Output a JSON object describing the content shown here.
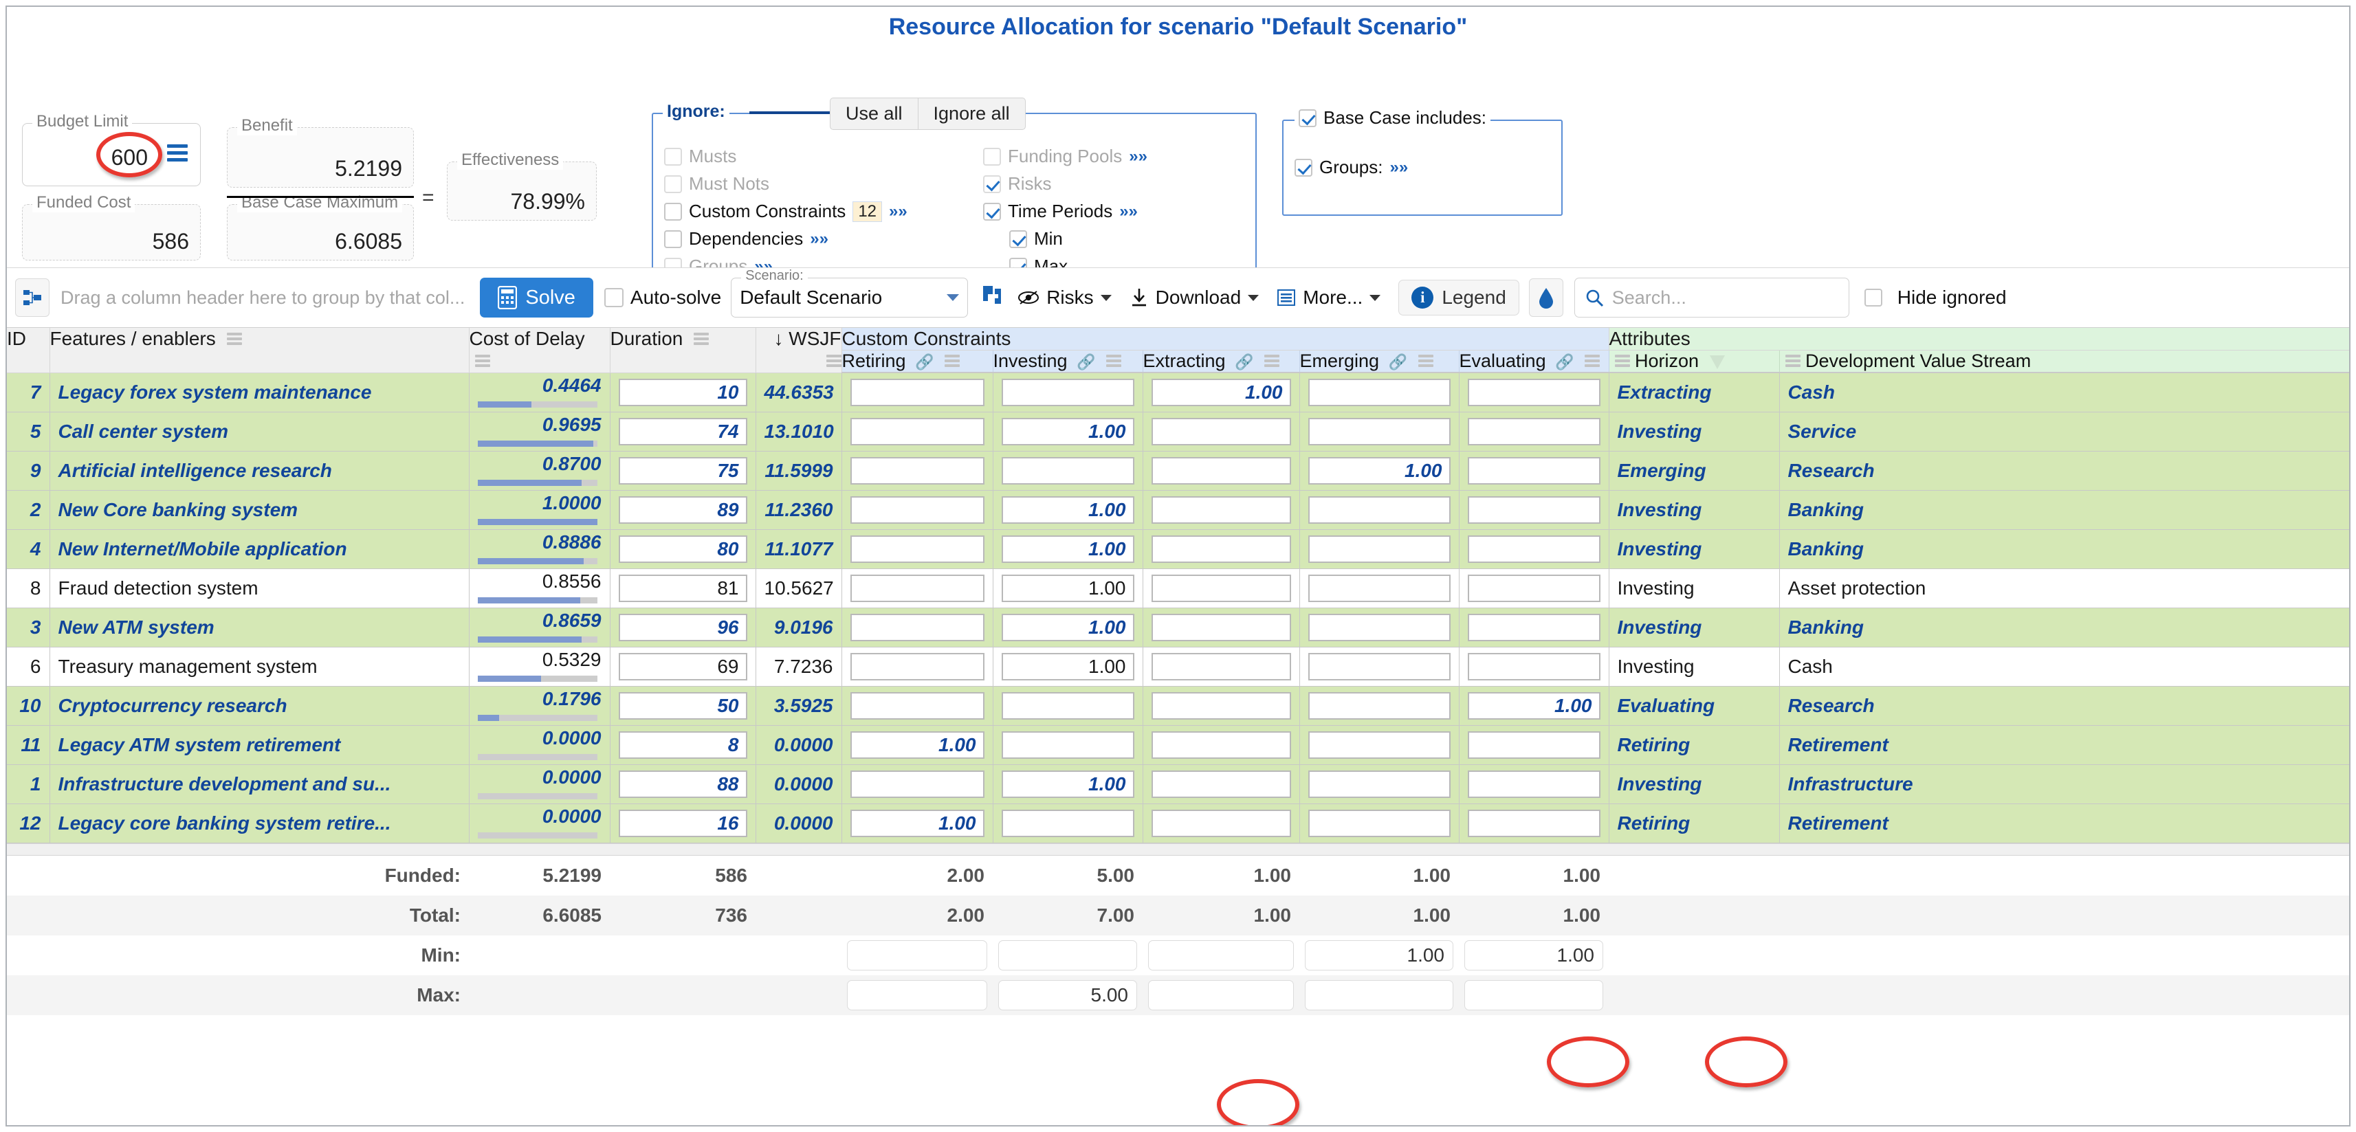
{
  "title": "Resource Allocation for scenario \"Default Scenario\"",
  "metrics": {
    "budget_limit_label": "Budget Limit",
    "budget_limit_value": "600",
    "benefit_label": "Benefit",
    "benefit_value": "5.2199",
    "effectiveness_label": "Effectiveness",
    "effectiveness_value": "78.99%",
    "funded_cost_label": "Funded Cost",
    "funded_cost_value": "586",
    "base_case_max_label": "Base Case Maximum",
    "base_case_max_value": "6.6085",
    "equals_sign": "="
  },
  "ignore_panel": {
    "legend": "Ignore:",
    "use_all": "Use all",
    "ignore_all": "Ignore all",
    "left_items": [
      {
        "label": "Musts",
        "checked": false,
        "dim": true,
        "chevron": false,
        "badge": null
      },
      {
        "label": "Must Nots",
        "checked": false,
        "dim": true,
        "chevron": false,
        "badge": null
      },
      {
        "label": "Custom Constraints",
        "checked": false,
        "dim": false,
        "chevron": true,
        "badge": "12"
      },
      {
        "label": "Dependencies",
        "checked": false,
        "dim": false,
        "chevron": true,
        "badge": null
      },
      {
        "label": "Groups",
        "checked": false,
        "dim": true,
        "chevron": true,
        "badge": null
      }
    ],
    "right_items": [
      {
        "label": "Funding Pools",
        "checked": false,
        "dim": true,
        "chevron": true,
        "indent": 0
      },
      {
        "label": "Risks",
        "checked": true,
        "dim": true,
        "chevron": false,
        "indent": 0
      },
      {
        "label": "Time Periods",
        "checked": true,
        "dim": false,
        "chevron": true,
        "indent": 0
      },
      {
        "label": "Min",
        "checked": true,
        "dim": false,
        "chevron": false,
        "indent": 1
      },
      {
        "label": "Max",
        "checked": true,
        "dim": false,
        "chevron": false,
        "indent": 1
      }
    ]
  },
  "base_case": {
    "title": "Base Case includes:",
    "title_checked": true,
    "groups_label": "Groups:",
    "groups_checked": true,
    "groups_chevron": "»»"
  },
  "toolbar": {
    "group_panel_placeholder": "Drag a column header here to group by that col...",
    "solve_label": "Solve",
    "autosolve_label": "Auto-solve",
    "autosolve_checked": false,
    "scenario_label": "Scenario:",
    "scenario_value": "Default Scenario",
    "risks_label": "Risks",
    "download_label": "Download",
    "more_label": "More...",
    "legend_label": "Legend",
    "search_placeholder": "Search...",
    "hide_ignored_label": "Hide ignored",
    "hide_ignored_checked": false
  },
  "grid": {
    "group_headers": [
      {
        "label": "ID",
        "span": 1
      },
      {
        "label": "Features / enablers",
        "span": 1
      },
      {
        "label": "Cost of Delay",
        "span": 1
      },
      {
        "label": "Duration",
        "span": 1
      },
      {
        "label": "WSJF",
        "span": 1,
        "sort": "↓"
      },
      {
        "label": "Custom Constraints",
        "span": 5,
        "kind": "cc"
      },
      {
        "label": "Attributes",
        "span": 2,
        "kind": "attr"
      }
    ],
    "sub_headers": [
      {
        "label": "Retiring",
        "kind": "cc",
        "link": true
      },
      {
        "label": "Investing",
        "kind": "cc",
        "link": true
      },
      {
        "label": "Extracting",
        "kind": "cc",
        "link": true
      },
      {
        "label": "Emerging",
        "kind": "cc",
        "link": true
      },
      {
        "label": "Evaluating",
        "kind": "cc",
        "link": true
      },
      {
        "label": "Horizon",
        "kind": "attr",
        "funnel": true
      },
      {
        "label": "Development Value Stream",
        "kind": "attr"
      }
    ],
    "rows": [
      {
        "id": "7",
        "name": "Legacy forex system maintenance",
        "cod": "0.4464",
        "cod_pct": 45,
        "duration": "10",
        "wsjf": "44.6353",
        "retiring": "",
        "investing": "",
        "extracting": "1.00",
        "emerging": "",
        "evaluating": "",
        "horizon": "Extracting",
        "dvs": "Cash",
        "funded": true
      },
      {
        "id": "5",
        "name": "Call center system",
        "cod": "0.9695",
        "cod_pct": 97,
        "duration": "74",
        "wsjf": "13.1010",
        "retiring": "",
        "investing": "1.00",
        "extracting": "",
        "emerging": "",
        "evaluating": "",
        "horizon": "Investing",
        "dvs": "Service",
        "funded": true
      },
      {
        "id": "9",
        "name": "Artificial intelligence research",
        "cod": "0.8700",
        "cod_pct": 87,
        "duration": "75",
        "wsjf": "11.5999",
        "retiring": "",
        "investing": "",
        "extracting": "",
        "emerging": "1.00",
        "evaluating": "",
        "horizon": "Emerging",
        "dvs": "Research",
        "funded": true
      },
      {
        "id": "2",
        "name": "New Core banking system",
        "cod": "1.0000",
        "cod_pct": 100,
        "duration": "89",
        "wsjf": "11.2360",
        "retiring": "",
        "investing": "1.00",
        "extracting": "",
        "emerging": "",
        "evaluating": "",
        "horizon": "Investing",
        "dvs": "Banking",
        "funded": true
      },
      {
        "id": "4",
        "name": "New Internet/Mobile application",
        "cod": "0.8886",
        "cod_pct": 89,
        "duration": "80",
        "wsjf": "11.1077",
        "retiring": "",
        "investing": "1.00",
        "extracting": "",
        "emerging": "",
        "evaluating": "",
        "horizon": "Investing",
        "dvs": "Banking",
        "funded": true
      },
      {
        "id": "8",
        "name": "Fraud detection system",
        "cod": "0.8556",
        "cod_pct": 86,
        "duration": "81",
        "wsjf": "10.5627",
        "retiring": "",
        "investing": "1.00",
        "extracting": "",
        "emerging": "",
        "evaluating": "",
        "horizon": "Investing",
        "dvs": "Asset protection",
        "funded": false
      },
      {
        "id": "3",
        "name": "New ATM system",
        "cod": "0.8659",
        "cod_pct": 87,
        "duration": "96",
        "wsjf": "9.0196",
        "retiring": "",
        "investing": "1.00",
        "extracting": "",
        "emerging": "",
        "evaluating": "",
        "horizon": "Investing",
        "dvs": "Banking",
        "funded": true
      },
      {
        "id": "6",
        "name": "Treasury management system",
        "cod": "0.5329",
        "cod_pct": 53,
        "duration": "69",
        "wsjf": "7.7236",
        "retiring": "",
        "investing": "1.00",
        "extracting": "",
        "emerging": "",
        "evaluating": "",
        "horizon": "Investing",
        "dvs": "Cash",
        "funded": false
      },
      {
        "id": "10",
        "name": "Cryptocurrency research",
        "cod": "0.1796",
        "cod_pct": 18,
        "duration": "50",
        "wsjf": "3.5925",
        "retiring": "",
        "investing": "",
        "extracting": "",
        "emerging": "",
        "evaluating": "1.00",
        "horizon": "Evaluating",
        "dvs": "Research",
        "funded": true
      },
      {
        "id": "11",
        "name": "Legacy ATM system retirement",
        "cod": "0.0000",
        "cod_pct": 0,
        "duration": "8",
        "wsjf": "0.0000",
        "retiring": "1.00",
        "investing": "",
        "extracting": "",
        "emerging": "",
        "evaluating": "",
        "horizon": "Retiring",
        "dvs": "Retirement",
        "funded": true
      },
      {
        "id": "1",
        "name": "Infrastructure development and su...",
        "cod": "0.0000",
        "cod_pct": 0,
        "duration": "88",
        "wsjf": "0.0000",
        "retiring": "",
        "investing": "1.00",
        "extracting": "",
        "emerging": "",
        "evaluating": "",
        "horizon": "Investing",
        "dvs": "Infrastructure",
        "funded": true
      },
      {
        "id": "12",
        "name": "Legacy core banking system retire...",
        "cod": "0.0000",
        "cod_pct": 0,
        "duration": "16",
        "wsjf": "0.0000",
        "retiring": "1.00",
        "investing": "",
        "extracting": "",
        "emerging": "",
        "evaluating": "",
        "horizon": "Retiring",
        "dvs": "Retirement",
        "funded": true
      }
    ],
    "footer": {
      "funded": {
        "label": "Funded:",
        "cod": "5.2199",
        "duration": "586",
        "retiring": "2.00",
        "investing": "5.00",
        "extracting": "1.00",
        "emerging": "1.00",
        "evaluating": "1.00"
      },
      "total": {
        "label": "Total:",
        "cod": "6.6085",
        "duration": "736",
        "retiring": "2.00",
        "investing": "7.00",
        "extracting": "1.00",
        "emerging": "1.00",
        "evaluating": "1.00"
      },
      "min": {
        "label": "Min:",
        "retiring": "",
        "investing": "",
        "extracting": "",
        "emerging": "1.00",
        "evaluating": "1.00"
      },
      "max": {
        "label": "Max:",
        "retiring": "",
        "investing": "5.00",
        "extracting": "",
        "emerging": "",
        "evaluating": ""
      }
    }
  },
  "annotations": {
    "circled": [
      "budget-limit-value",
      "min-emerging",
      "min-evaluating",
      "max-investing"
    ],
    "highlight_color": "#e8382f"
  }
}
